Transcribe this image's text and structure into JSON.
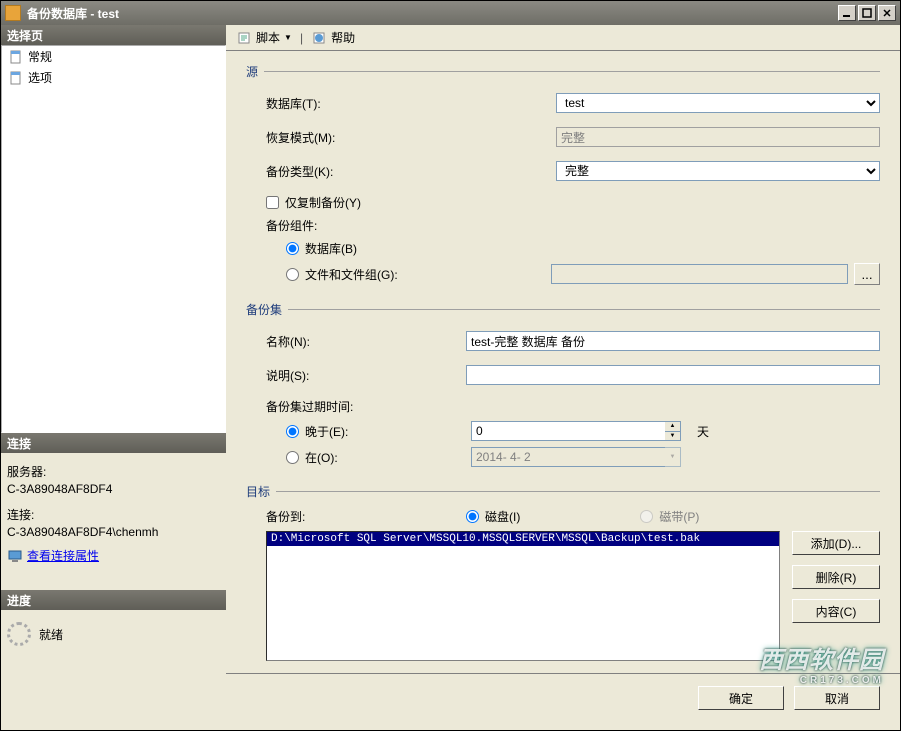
{
  "window": {
    "title": "备份数据库 - test"
  },
  "left": {
    "select_page_header": "选择页",
    "nav": [
      {
        "label": "常规",
        "icon": "page-icon"
      },
      {
        "label": "选项",
        "icon": "page-icon"
      }
    ],
    "connection": {
      "header": "连接",
      "server_label": "服务器:",
      "server_value": "C-3A89048AF8DF4",
      "conn_label": "连接:",
      "conn_value": "C-3A89048AF8DF4\\chenmh",
      "view_props": "查看连接属性"
    },
    "progress": {
      "header": "进度",
      "status": "就绪"
    }
  },
  "toolbar": {
    "script": "脚本",
    "help": "帮助"
  },
  "source": {
    "legend": "源",
    "database_label": "数据库(T):",
    "database_value": "test",
    "recovery_label": "恢复模式(M):",
    "recovery_value": "完整",
    "backup_type_label": "备份类型(K):",
    "backup_type_value": "完整",
    "copy_only_label": "仅复制备份(Y)",
    "component_label": "备份组件:",
    "radio_database": "数据库(B)",
    "radio_filegroups": "文件和文件组(G):"
  },
  "backup_set": {
    "legend": "备份集",
    "name_label": "名称(N):",
    "name_value": "test-完整 数据库 备份",
    "desc_label": "说明(S):",
    "desc_value": "",
    "expire_label": "备份集过期时间:",
    "after_label": "晚于(E):",
    "after_value": "0",
    "after_unit": "天",
    "on_label": "在(O):",
    "on_value": "2014- 4- 2"
  },
  "destination": {
    "legend": "目标",
    "backup_to_label": "备份到:",
    "disk_label": "磁盘(I)",
    "tape_label": "磁带(P)",
    "path": "D:\\Microsoft SQL Server\\MSSQL10.MSSQLSERVER\\MSSQL\\Backup\\test.bak",
    "add_btn": "添加(D)...",
    "remove_btn": "删除(R)",
    "contents_btn": "内容(C)"
  },
  "buttons": {
    "ok": "确定",
    "cancel": "取消"
  },
  "watermark": {
    "main": "西西软件园",
    "sub": "CR173.COM"
  }
}
